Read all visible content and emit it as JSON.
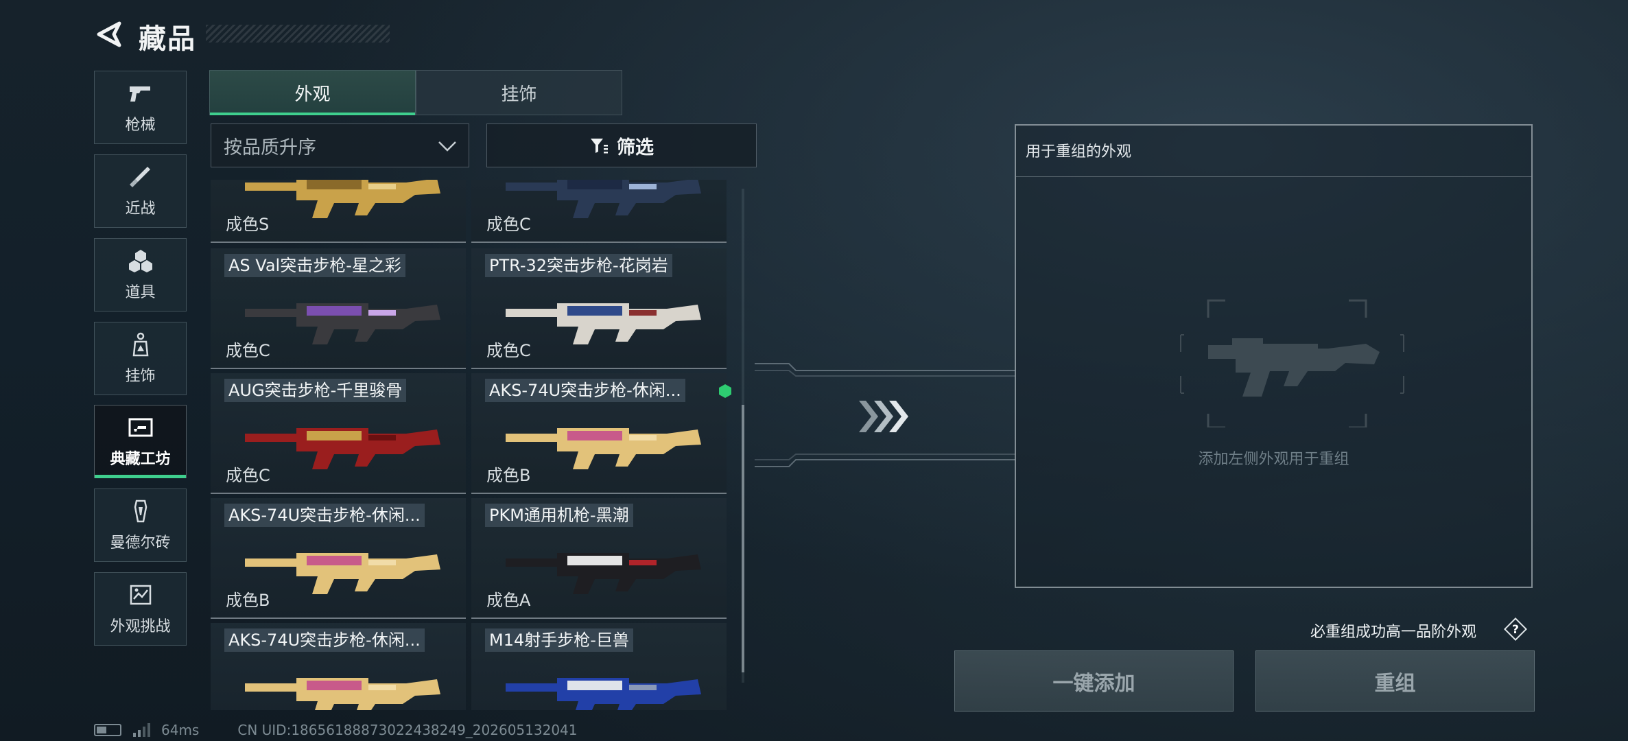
{
  "header": {
    "title": "藏品"
  },
  "categories": [
    {
      "label": "枪械",
      "icon": "pistol-icon"
    },
    {
      "label": "近战",
      "icon": "knife-icon"
    },
    {
      "label": "道具",
      "icon": "grenades-icon"
    },
    {
      "label": "挂饰",
      "icon": "charm-tag-icon"
    },
    {
      "label": "典藏工坊",
      "icon": "workshop-icon",
      "active": true
    },
    {
      "label": "曼德尔砖",
      "icon": "mandel-brick-icon"
    },
    {
      "label": "外观挑战",
      "icon": "challenge-icon"
    }
  ],
  "tabs": [
    {
      "label": "外观",
      "active": true
    },
    {
      "label": "挂饰",
      "active": false
    }
  ],
  "sort": {
    "selected": "按品质升序"
  },
  "filter": {
    "label": "筛选"
  },
  "items": [
    {
      "name": "",
      "condition": "成色S",
      "skin": "gold"
    },
    {
      "name": "",
      "condition": "成色C",
      "skin": "blue-dark"
    },
    {
      "name": "AS Val突击步枪-星之彩",
      "condition": "成色C",
      "skin": "purple"
    },
    {
      "name": "PTR-32突击步枪-花岗岩",
      "condition": "成色C",
      "skin": "granite"
    },
    {
      "name": "AUG突击步枪-千里骏骨",
      "condition": "成色C",
      "skin": "red-gold"
    },
    {
      "name": "AKS-74U突击步枪-休闲...",
      "condition": "成色B",
      "skin": "pink-gold",
      "tag_color": "#2ecc71"
    },
    {
      "name": "AKS-74U突击步枪-休闲...",
      "condition": "成色B",
      "skin": "pink-gold"
    },
    {
      "name": "PKM通用机枪-黑潮",
      "condition": "成色A",
      "skin": "black-white"
    },
    {
      "name": "AKS-74U突击步枪-休闲...",
      "condition": "",
      "skin": "pink-gold"
    },
    {
      "name": "M14射手步枪-巨兽",
      "condition": "",
      "skin": "blue-white"
    }
  ],
  "recombine": {
    "title": "用于重组的外观",
    "hint": "添加左侧外观用于重组",
    "guarantee": "必重组成功高一品阶外观",
    "auto_add_label": "一键添加",
    "recombine_label": "重组"
  },
  "status": {
    "ping": "64ms",
    "uid": "CN UID:18656188873022438249_202605132041"
  },
  "colors": {
    "accent": "#3fcf8e",
    "tag_green": "#2ecc71"
  }
}
